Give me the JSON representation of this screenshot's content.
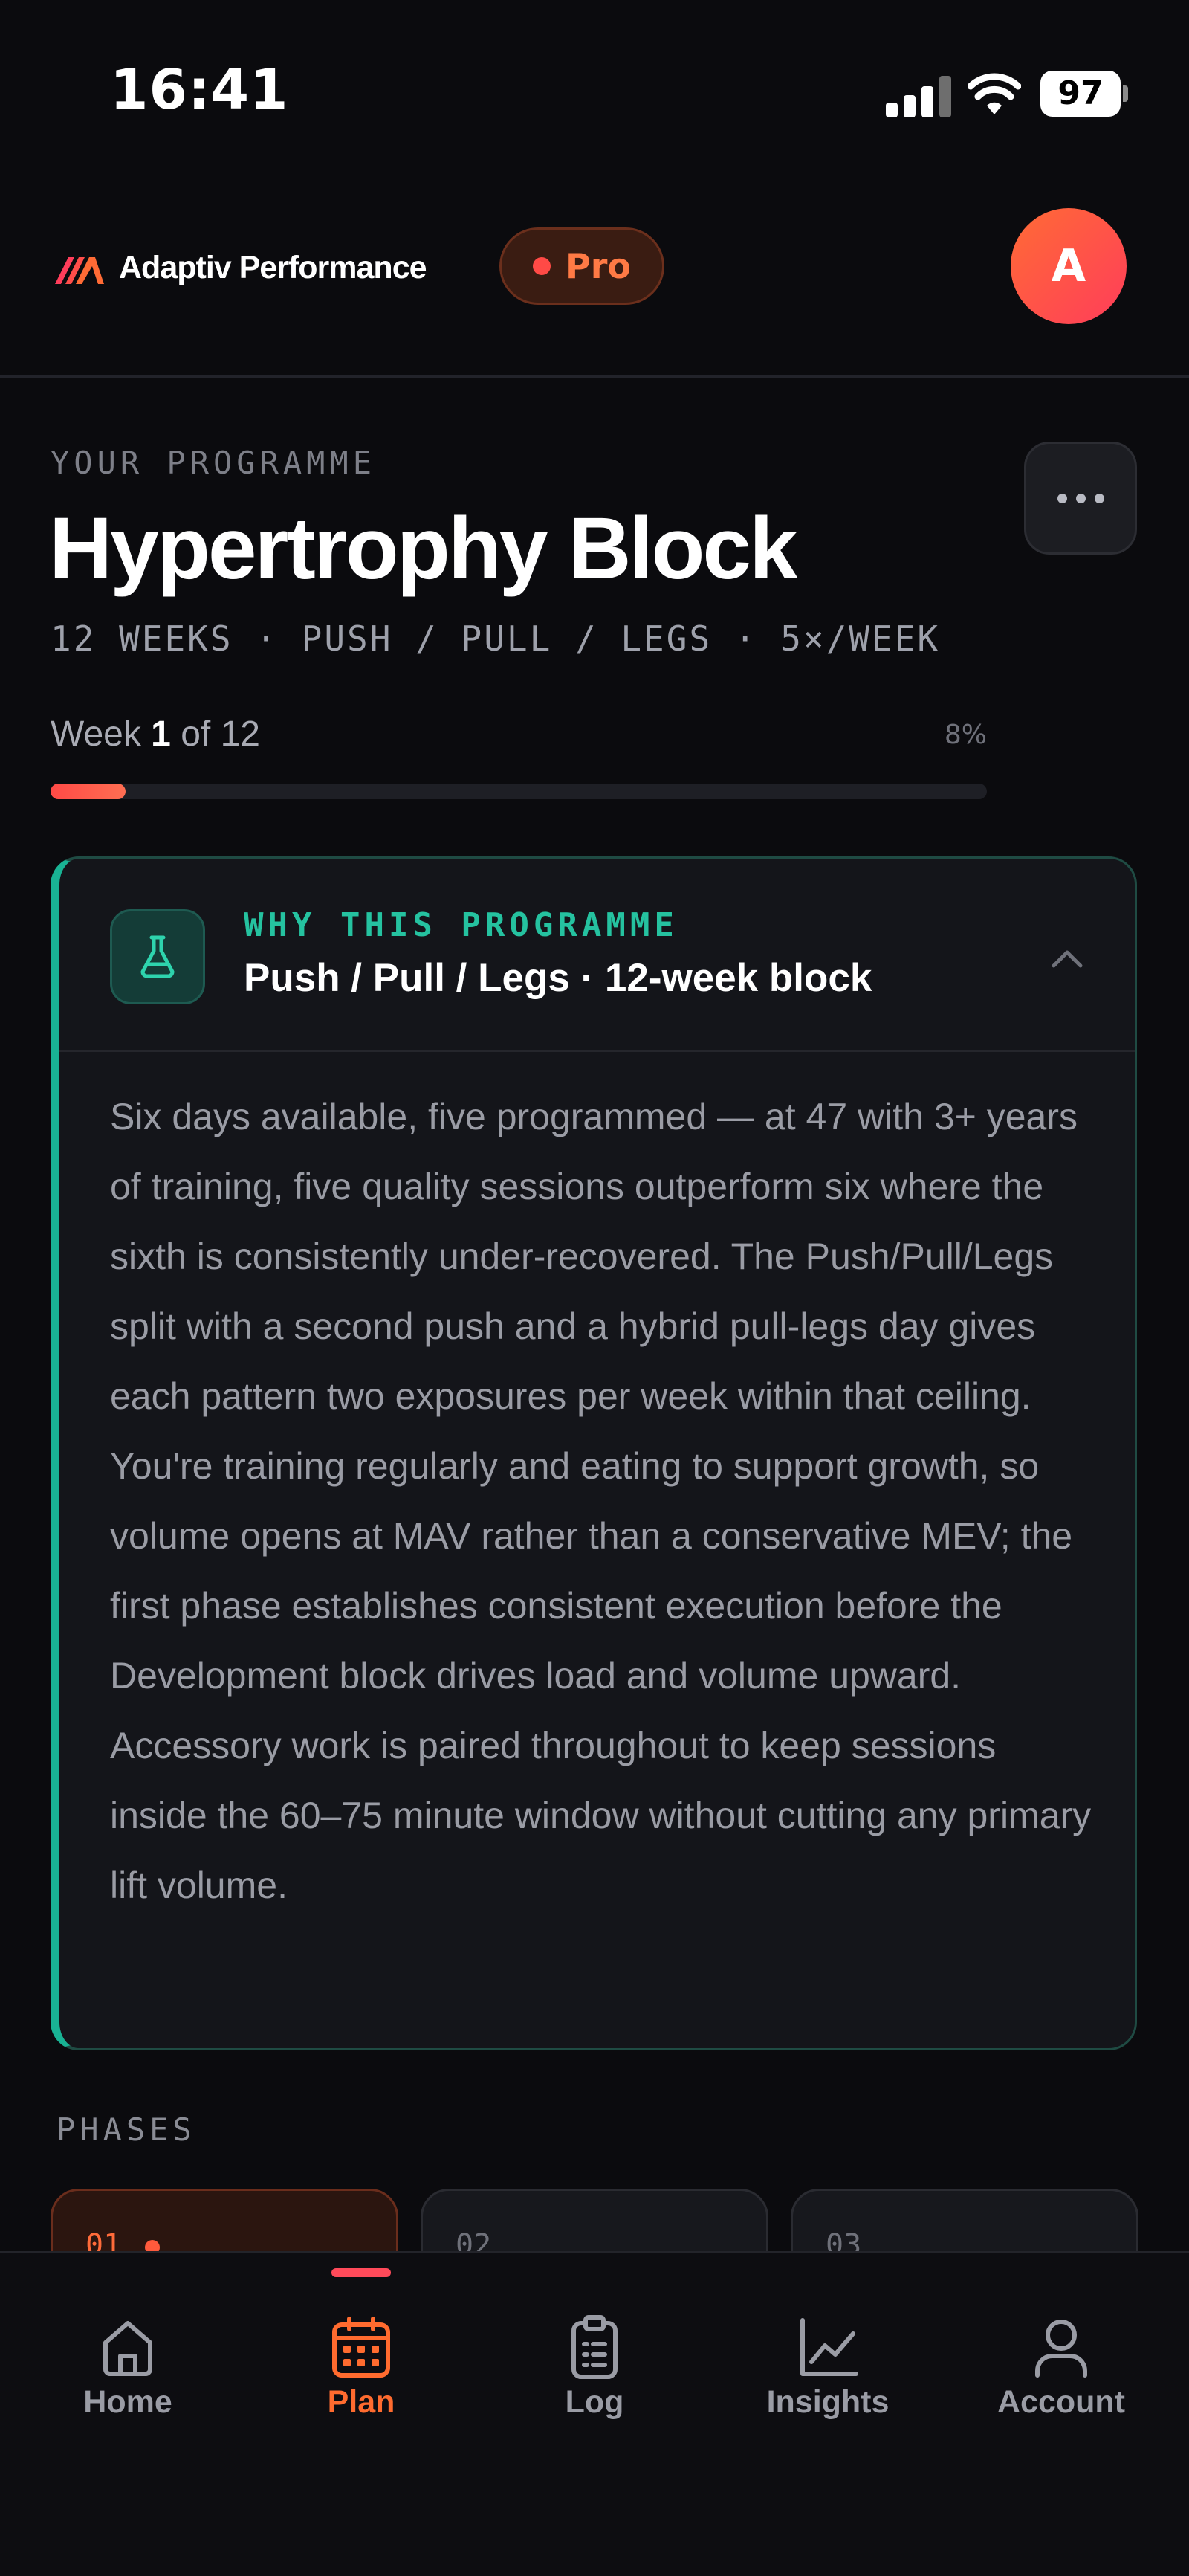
{
  "status_bar": {
    "time": "16:41",
    "battery": "97"
  },
  "header": {
    "brand_name": "Adaptiv Performance",
    "badge_label": "Pro",
    "avatar_initial": "A"
  },
  "programme": {
    "eyebrow": "YOUR PROGRAMME",
    "title": "Hypertrophy Block",
    "meta": "12 WEEKS · PUSH / PULL / LEGS · 5×/WEEK",
    "week_prefix": "Week ",
    "week_current": "1",
    "week_suffix": " of 12",
    "percent_label": "8%",
    "progress_fraction": 0.08
  },
  "why_card": {
    "eyebrow": "WHY THIS PROGRAMME",
    "title": "Push / Pull / Legs · 12-week block",
    "body": "Six days available, five programmed — at 47 with 3+ years of training, five quality sessions outperform six where the sixth is consistently under-recovered. The Push/Pull/Legs split with a second push and a hybrid pull-legs day gives each pattern two exposures per week within that ceiling. You're training regularly and eating to support growth, so volume opens at MAV rather than a conservative MEV; the first phase establishes consistent execution before the Development block drives load and volume upward. Accessory work is paired throughout to keep sessions inside the 60–75 minute window without cutting any primary lift volume."
  },
  "phases": {
    "label": "PHASES",
    "items": [
      {
        "number": "01",
        "active": true
      },
      {
        "number": "02",
        "active": false
      },
      {
        "number": "03",
        "active": false
      }
    ]
  },
  "tab_bar": {
    "items": [
      {
        "label": "Home",
        "icon": "home-icon"
      },
      {
        "label": "Plan",
        "icon": "calendar-icon",
        "active": true
      },
      {
        "label": "Log",
        "icon": "clipboard-icon"
      },
      {
        "label": "Insights",
        "icon": "chart-line-icon"
      },
      {
        "label": "Account",
        "icon": "user-icon"
      }
    ]
  },
  "colors": {
    "background": "#0b0b0e",
    "accent_orange": "#ff6b2f",
    "accent_teal": "#19b394",
    "card_bg": "#14151a"
  }
}
